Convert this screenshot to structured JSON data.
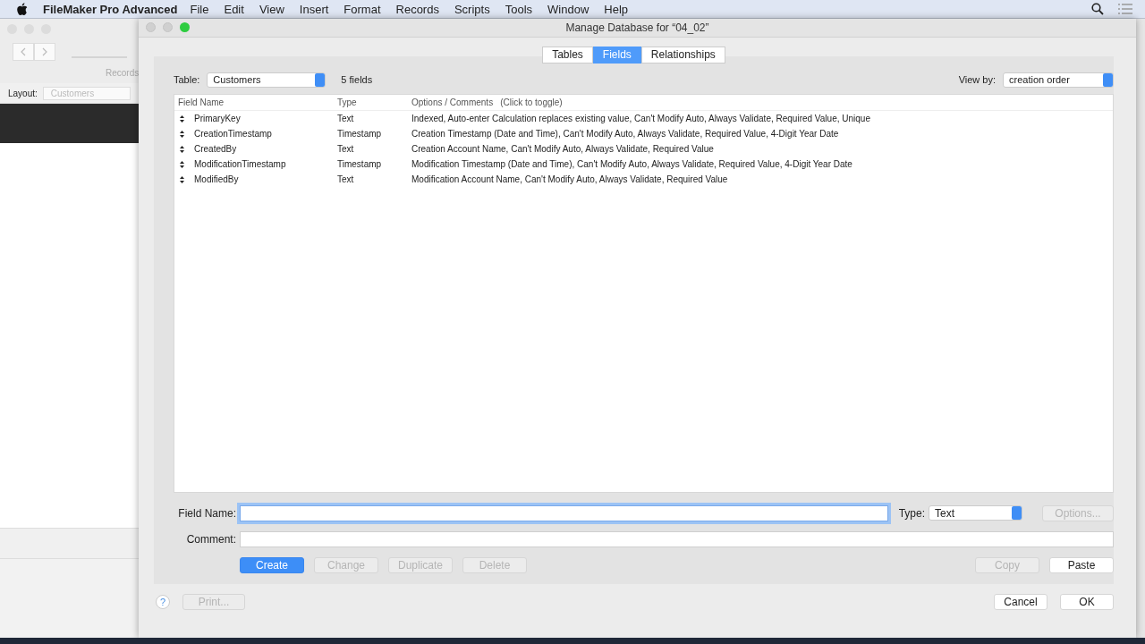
{
  "menu_bar": {
    "app_name": "FileMaker Pro Advanced",
    "items": [
      "File",
      "Edit",
      "View",
      "Insert",
      "Format",
      "Records",
      "Scripts",
      "Tools",
      "Window",
      "Help"
    ]
  },
  "background_window": {
    "records_label": "Records",
    "layout_label": "Layout:",
    "layout_value": "Customers"
  },
  "dialog": {
    "title": "Manage Database for “04_02”",
    "tabs": [
      {
        "label": "Tables",
        "selected": false
      },
      {
        "label": "Fields",
        "selected": true
      },
      {
        "label": "Relationships",
        "selected": false
      }
    ],
    "table_label": "Table:",
    "table_value": "Customers",
    "field_count": "5 fields",
    "view_by_label": "View by:",
    "view_by_value": "creation order",
    "columns": [
      {
        "label": "Field Name"
      },
      {
        "label": "Type"
      },
      {
        "label": "Options / Comments",
        "hint": "(Click to toggle)"
      }
    ],
    "fields": [
      {
        "name": "PrimaryKey",
        "type": "Text",
        "options": "Indexed, Auto-enter Calculation replaces existing value, Can't Modify Auto, Always Validate, Required Value, Unique"
      },
      {
        "name": "CreationTimestamp",
        "type": "Timestamp",
        "options": "Creation Timestamp (Date and Time), Can't Modify Auto, Always Validate, Required Value, 4-Digit Year Date"
      },
      {
        "name": "CreatedBy",
        "type": "Text",
        "options": "Creation Account Name, Can't Modify Auto, Always Validate, Required Value"
      },
      {
        "name": "ModificationTimestamp",
        "type": "Timestamp",
        "options": "Modification Timestamp (Date and Time), Can't Modify Auto, Always Validate, Required Value, 4-Digit Year Date"
      },
      {
        "name": "ModifiedBy",
        "type": "Text",
        "options": "Modification Account Name, Can't Modify Auto, Always Validate, Required Value"
      }
    ],
    "field_name_label": "Field Name:",
    "type_label": "Type:",
    "type_value": "Text",
    "options_button": {
      "label": "Options...",
      "disabled": true
    },
    "comment_label": "Comment:",
    "actions": [
      {
        "label": "Create",
        "disabled": false,
        "default": true
      },
      {
        "label": "Change",
        "disabled": true,
        "default": false
      },
      {
        "label": "Duplicate",
        "disabled": true,
        "default": false
      },
      {
        "label": "Delete",
        "disabled": true,
        "default": false
      }
    ],
    "clipboard": [
      {
        "label": "Copy",
        "disabled": true
      },
      {
        "label": "Paste",
        "disabled": false
      }
    ],
    "help_label": "?",
    "print_button": {
      "label": "Print...",
      "disabled": true
    },
    "footer_buttons": [
      {
        "label": "Cancel"
      },
      {
        "label": "OK"
      }
    ]
  }
}
